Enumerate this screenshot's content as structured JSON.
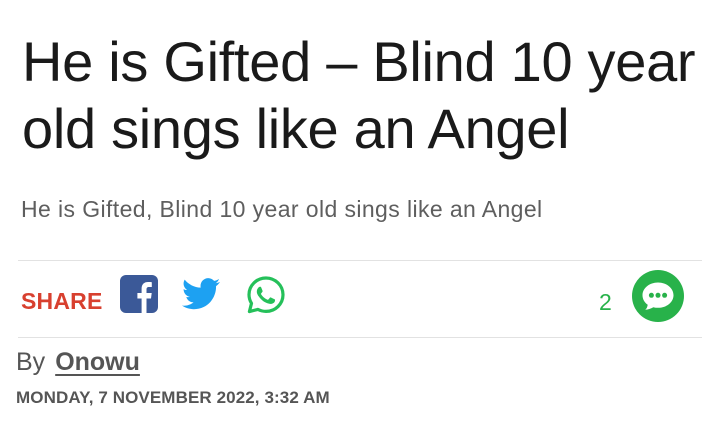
{
  "article": {
    "title": "He is Gifted – Blind 10 year old sings like an Angel",
    "subtitle": "He is Gifted, Blind 10 year old sings like an Angel",
    "byline_prefix": "By",
    "author": "Onowu",
    "date": "MONDAY, 7 NOVEMBER 2022, 3:32 AM"
  },
  "share": {
    "label": "SHARE",
    "icons": [
      "facebook-icon",
      "twitter-icon",
      "whatsapp-icon"
    ]
  },
  "comments": {
    "count": "2",
    "icon": "comment-bubble-icon"
  },
  "colors": {
    "share_label": "#d8402f",
    "facebook": "#3b5998",
    "twitter": "#1da1f2",
    "whatsapp": "#25c05a",
    "comments": "#28b24a",
    "title": "#1a1a1a",
    "muted_text": "#555555"
  }
}
